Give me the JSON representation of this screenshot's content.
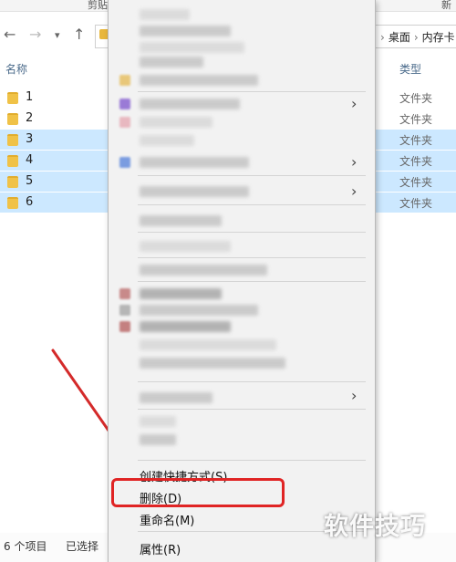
{
  "ribbon": {
    "left_tab": "剪贴板",
    "right_tab": "新"
  },
  "address_bar": {
    "crumbs": [
      "桌面",
      "内存卡"
    ]
  },
  "columns": {
    "name": "名称",
    "type": "类型"
  },
  "files": [
    {
      "name": "1",
      "type": "文件夹",
      "selected": false
    },
    {
      "name": "2",
      "type": "文件夹",
      "selected": false
    },
    {
      "name": "3",
      "type": "文件夹",
      "selected": true
    },
    {
      "name": "4",
      "type": "文件夹",
      "selected": true
    },
    {
      "name": "5",
      "type": "文件夹",
      "selected": true
    },
    {
      "name": "6",
      "type": "文件夹",
      "selected": true
    }
  ],
  "status": {
    "item_count": "6 个项目",
    "selected": "已选择"
  },
  "context_menu": {
    "create_shortcut": "创建快捷方式(S)",
    "delete": "删除(D)",
    "rename": "重命名(M)",
    "properties": "属性(R)"
  },
  "watermark": "软件技巧",
  "colors": {
    "selection": "#cce8ff",
    "highlight_box": "#e02424",
    "folder": "#f0c247",
    "arrow": "#d42a2a"
  }
}
